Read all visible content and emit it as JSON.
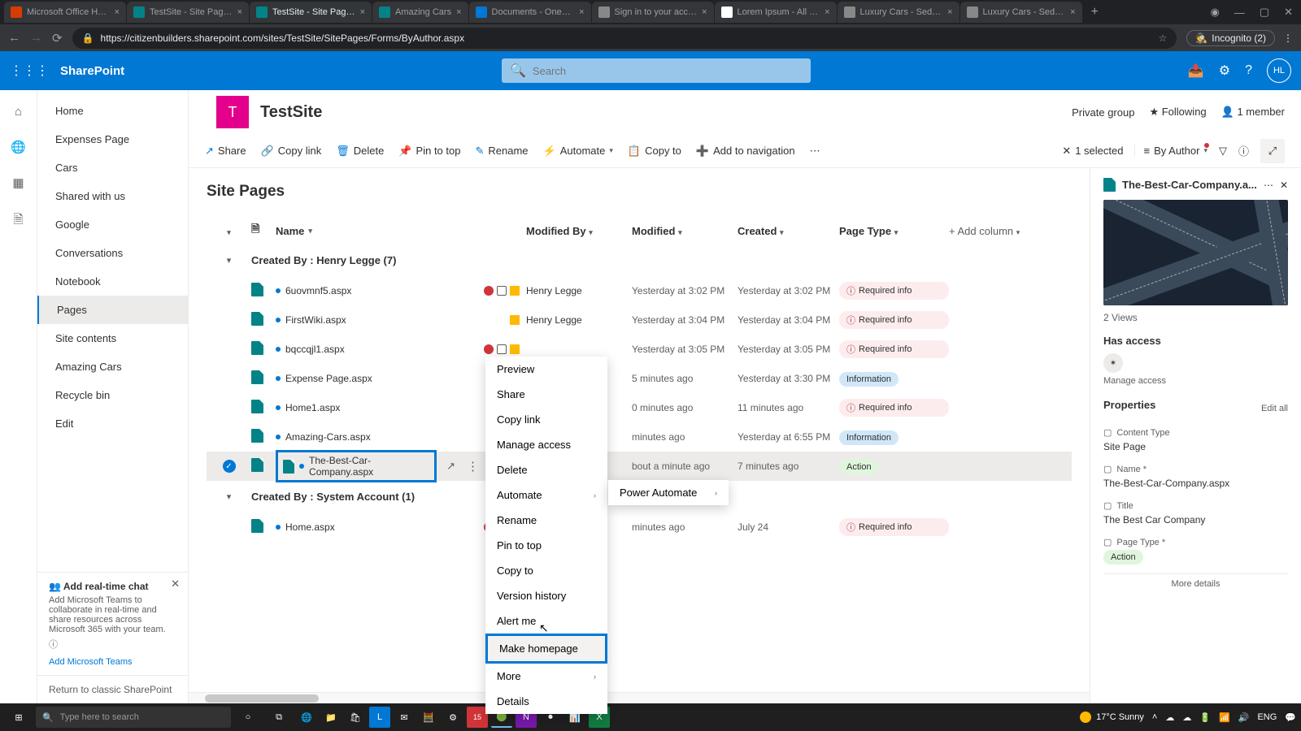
{
  "browser": {
    "tabs": [
      {
        "label": "Microsoft Office Home"
      },
      {
        "label": "TestSite - Site Pages -"
      },
      {
        "label": "TestSite - Site Pages -",
        "active": true
      },
      {
        "label": "Amazing Cars"
      },
      {
        "label": "Documents - OneDriv"
      },
      {
        "label": "Sign in to your accou"
      },
      {
        "label": "Lorem Ipsum - All the"
      },
      {
        "label": "Luxury Cars - Sedans,"
      },
      {
        "label": "Luxury Cars - Sedans,"
      }
    ],
    "url": "https://citizenbuilders.sharepoint.com/sites/TestSite/SitePages/Forms/ByAuthor.aspx",
    "incognito_label": "Incognito (2)"
  },
  "suitebar": {
    "brand": "SharePoint",
    "search_placeholder": "Search",
    "avatar": "HL"
  },
  "site": {
    "logo_letter": "T",
    "title": "TestSite",
    "privacy": "Private group",
    "following": "Following",
    "members": "1 member"
  },
  "leftnav": {
    "items": [
      "Home",
      "Expenses Page",
      "Cars",
      "Shared with us",
      "Google",
      "Conversations",
      "Notebook",
      "Pages",
      "Site contents",
      "Amazing Cars",
      "Recycle bin",
      "Edit"
    ],
    "selected": "Pages",
    "promo_title": "Add real-time chat",
    "promo_body": "Add Microsoft Teams to collaborate in real-time and share resources across Microsoft 365 with your team.",
    "promo_link": "Add Microsoft Teams",
    "classic": "Return to classic SharePoint"
  },
  "commandbar": {
    "items": [
      "Share",
      "Copy link",
      "Delete",
      "Pin to top",
      "Rename",
      "Automate",
      "Copy to",
      "Add to navigation"
    ],
    "selected_text": "1 selected",
    "view_label": "By Author"
  },
  "list": {
    "title": "Site Pages",
    "columns": [
      "Name",
      "Modified By",
      "Modified",
      "Created",
      "Page Type",
      "Add column"
    ],
    "groups": [
      {
        "header": "Created By : Henry Legge (7)"
      },
      {
        "header": "Created By : System Account (1)"
      }
    ],
    "rows": [
      {
        "name": "6uovmnf5.aspx",
        "modby": "Henry Legge",
        "mod": "Yesterday at 3:02 PM",
        "created": "Yesterday at 3:02 PM",
        "ptype": "Required info",
        "ptype_kind": "req",
        "ind": [
          "red",
          "link",
          "warn"
        ]
      },
      {
        "name": "FirstWiki.aspx",
        "modby": "Henry Legge",
        "mod": "Yesterday at 3:04 PM",
        "created": "Yesterday at 3:04 PM",
        "ptype": "Required info",
        "ptype_kind": "req",
        "ind": [
          "warn"
        ]
      },
      {
        "name": "bqccqjl1.aspx",
        "modby": "",
        "mod": "Yesterday at 3:05 PM",
        "created": "Yesterday at 3:05 PM",
        "ptype": "Required info",
        "ptype_kind": "req",
        "ind": [
          "red",
          "link",
          "warn"
        ]
      },
      {
        "name": "Expense Page.aspx",
        "modby": "",
        "mod": "5 minutes ago",
        "created": "Yesterday at 3:30 PM",
        "ptype": "Information",
        "ptype_kind": "info",
        "ind": []
      },
      {
        "name": "Home1.aspx",
        "modby": "",
        "mod": "0 minutes ago",
        "created": "11 minutes ago",
        "ptype": "Required info",
        "ptype_kind": "req",
        "ind": [
          "red",
          "warn"
        ]
      },
      {
        "name": "Amazing-Cars.aspx",
        "modby": "",
        "mod": "minutes ago",
        "created": "Yesterday at 6:55 PM",
        "ptype": "Information",
        "ptype_kind": "info",
        "ind": [
          "red"
        ]
      },
      {
        "name": "The-Best-Car-Company.aspx",
        "modby": "",
        "mod": "bout a minute ago",
        "created": "7 minutes ago",
        "ptype": "Action",
        "ptype_kind": "act",
        "selected": true,
        "boxed": true,
        "ind": []
      },
      {
        "name": "Home.aspx",
        "modby": "",
        "mod": "minutes ago",
        "created": "July 24",
        "ptype": "Required info",
        "ptype_kind": "req",
        "group2": true,
        "ind": [
          "red",
          "link",
          "warn"
        ]
      }
    ]
  },
  "context_menu": {
    "items": [
      "Preview",
      "Share",
      "Copy link",
      "Manage access",
      "Delete",
      "Automate",
      "Rename",
      "Pin to top",
      "Copy to",
      "Version history",
      "Alert me",
      "Make homepage",
      "More",
      "Details"
    ],
    "highlighted": "Make homepage",
    "submenu_parent": "Automate",
    "submenu": [
      "Power Automate"
    ]
  },
  "details": {
    "filename": "The-Best-Car-Company.a...",
    "views": "2 Views",
    "has_access": "Has access",
    "manage": "Manage access",
    "properties": "Properties",
    "edit_all": "Edit all",
    "props": [
      {
        "label": "Content Type",
        "value": "Site Page"
      },
      {
        "label": "Name *",
        "value": "The-Best-Car-Company.aspx"
      },
      {
        "label": "Title",
        "value": "The Best Car Company"
      },
      {
        "label": "Page Type *",
        "value": "Action",
        "badge": "act"
      }
    ],
    "more": "More details"
  },
  "taskbar": {
    "search_placeholder": "Type here to search",
    "weather": "17°C  Sunny",
    "lang": "ENG"
  }
}
